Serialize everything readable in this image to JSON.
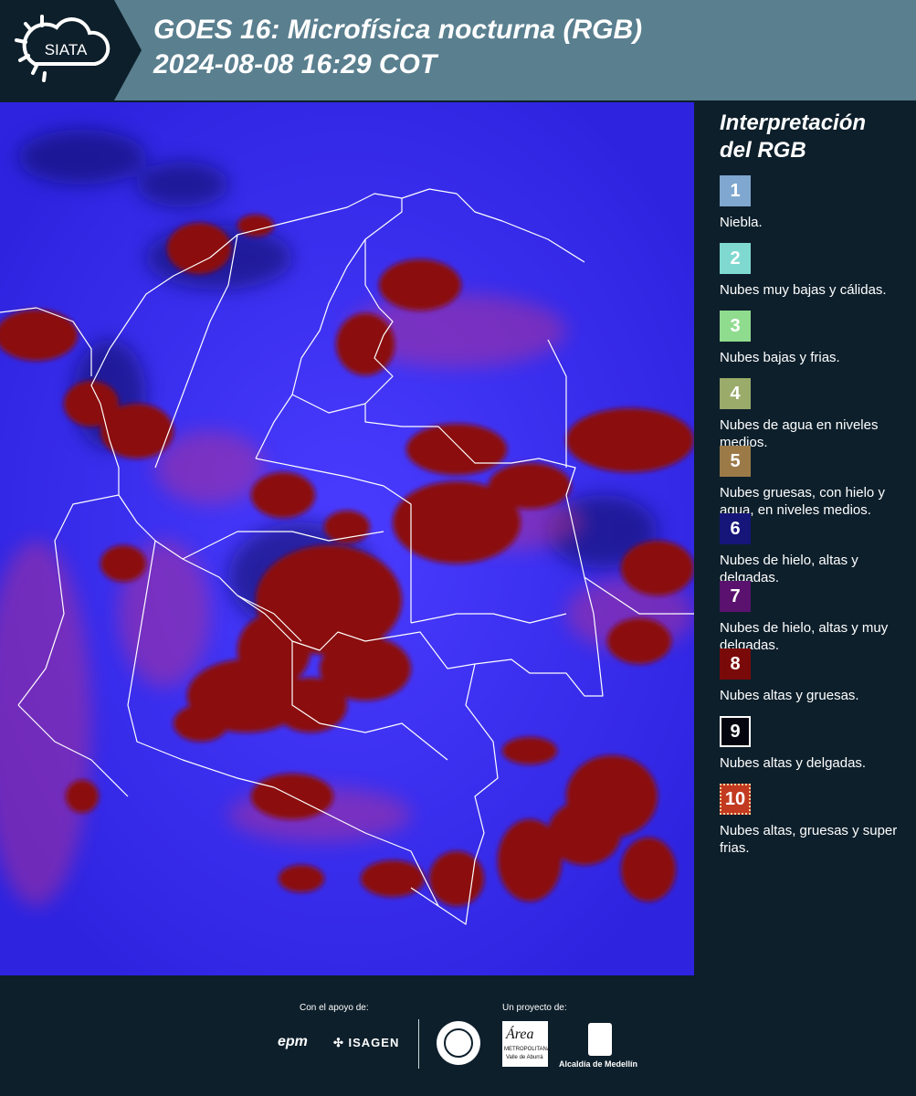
{
  "header": {
    "logo_text": "SIATA",
    "title_line1": "GOES 16: Microfísica nocturna (RGB)",
    "title_line2": " 2024-08-08 16:29 COT"
  },
  "legend": {
    "title": "Interpretación del RGB",
    "items": [
      {
        "number": "1",
        "label": "Niebla.",
        "color": "#7fa7cf"
      },
      {
        "number": "2",
        "label": "Nubes muy bajas y cálidas.",
        "color": "#7fd9d0"
      },
      {
        "number": "3",
        "label": "Nubes bajas y frias.",
        "color": "#8fdc8f"
      },
      {
        "number": "4",
        "label": "Nubes de agua en niveles medios.",
        "color": "#9aab6a"
      },
      {
        "number": "5",
        "label": "Nubes gruesas, con hielo y agua, en niveles medios.",
        "color": "#9c7a48"
      },
      {
        "number": "6",
        "label": "Nubes de hielo, altas y delgadas.",
        "color": "#15157a"
      },
      {
        "number": "7",
        "label": "Nubes de hielo, altas y muy delgadas.",
        "color": "#5a126e"
      },
      {
        "number": "8",
        "label": "Nubes altas y gruesas.",
        "color": "#7a0a0a"
      },
      {
        "number": "9",
        "label": "Nubes altas y delgadas.",
        "color": "#050510"
      },
      {
        "number": "10",
        "label": "Nubes altas, gruesas y super frias.",
        "color": "#c23a20"
      }
    ]
  },
  "footer": {
    "support_label": "Con el apoyo de:",
    "project_label": "Un proyecto de:",
    "sponsor_epm": "epm",
    "sponsor_isagen": "ISAGEN",
    "partner_area_line1": "Área",
    "partner_area_line2": "METROPOLITANA",
    "partner_area_line3": "Valle de Aburrá",
    "partner_alcaldia": "Alcaldía de Medellín"
  },
  "colors": {
    "background": "#0d1f2b",
    "header": "#5a7f8f",
    "map_base": "#3a2cf2",
    "thick_cloud": "#8b0a0a",
    "thin_cloud": "#c0308a",
    "borders": "#ffffff"
  }
}
